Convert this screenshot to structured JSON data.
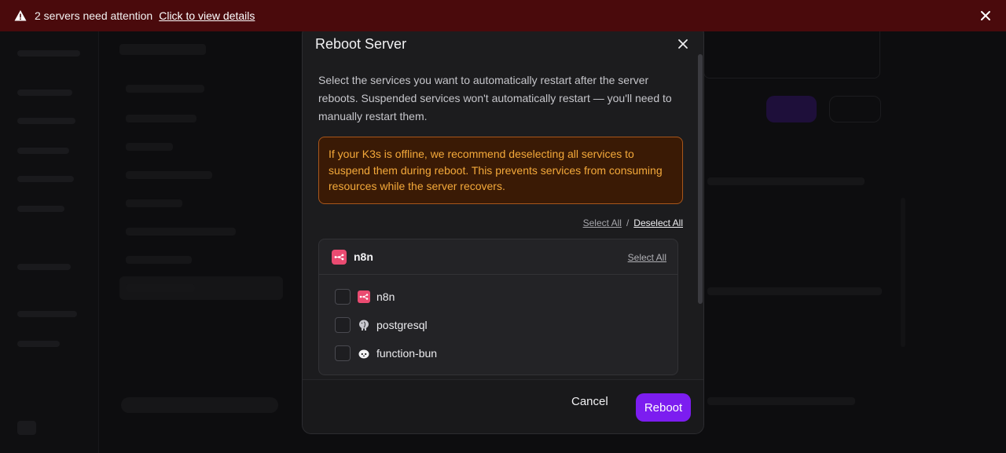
{
  "banner": {
    "message": "2 servers need attention",
    "link": "Click to view details",
    "icon": "warning-triangle-icon",
    "bg_color": "#4a0a0c"
  },
  "modal": {
    "title": "Reboot Server",
    "description": "Select the services you want to automatically restart after the server reboots. Suspended services won't automatically restart — you'll need to manually restart them.",
    "alert": "If your K3s is offline, we recommend deselecting all services to suspend them during reboot. This prevents services from consuming resources while the server recovers.",
    "select_all": "Select All",
    "separator": "/",
    "deselect_all": "Deselect All",
    "group": {
      "name": "n8n",
      "select_all": "Select All",
      "services": [
        {
          "label": "n8n",
          "icon": "n8n-icon",
          "checked": false
        },
        {
          "label": "postgresql",
          "icon": "postgresql-elephant-icon",
          "checked": false
        },
        {
          "label": "function-bun",
          "icon": "bun-icon",
          "checked": false
        }
      ]
    },
    "cancel": "Cancel",
    "reboot": "Reboot"
  },
  "colors": {
    "accent": "#7c1df0",
    "alert_bg": "#3a1a05",
    "alert_border": "#a8561b",
    "alert_text": "#f4a93a",
    "n8n_brand": "#ea4b71"
  }
}
